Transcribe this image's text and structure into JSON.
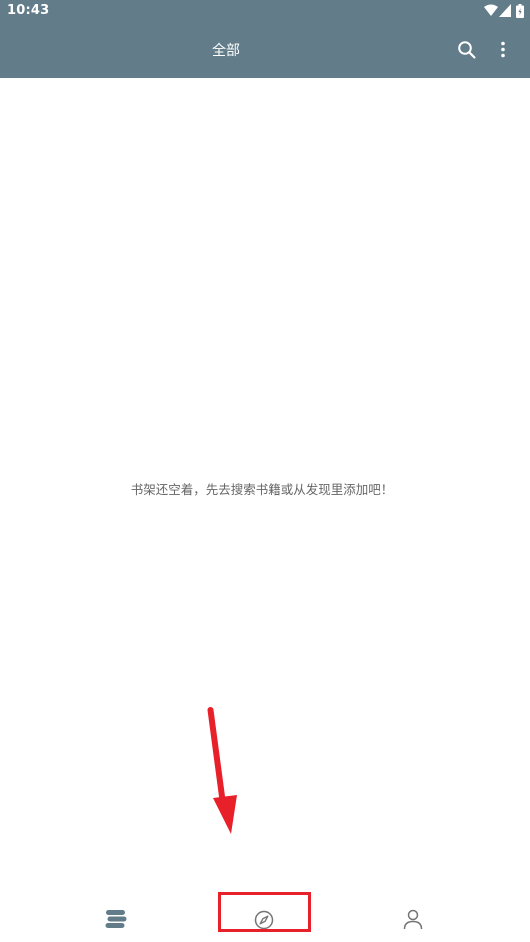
{
  "status_bar": {
    "time": "10:43",
    "icons": [
      "wifi-icon",
      "signal-icon",
      "battery-icon"
    ]
  },
  "toolbar": {
    "title": "全部",
    "actions": [
      "search-icon",
      "more-vert-icon"
    ]
  },
  "bookshelf": {
    "empty_message": "书架还空着，先去搜索书籍或从发现里添加吧！"
  },
  "bottom_nav": {
    "items": [
      {
        "icon": "bookshelf-icon",
        "active": true
      },
      {
        "icon": "compass-icon",
        "active": false
      },
      {
        "icon": "person-icon",
        "active": false
      }
    ]
  },
  "annotation": {
    "highlight_target": "compass-icon"
  },
  "colors": {
    "appbar": "#627c8a",
    "nav_active": "#627c8a",
    "nav_inactive": "#757575",
    "annotation": "#e8202a",
    "empty_text": "#666666"
  }
}
